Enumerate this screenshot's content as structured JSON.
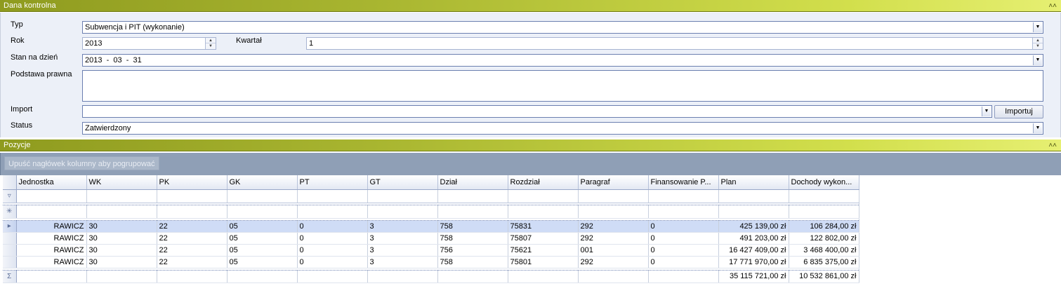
{
  "header1": {
    "title": "Dana kontrolna"
  },
  "form": {
    "typ_label": "Typ",
    "typ_value": "Subwencja i PIT (wykonanie)",
    "rok_label": "Rok",
    "rok_value": "2013",
    "kwartal_label": "Kwartał",
    "kwartal_value": "1",
    "stan_label": "Stan na dzień",
    "stan_value": "2013  -  03  -  31",
    "podstawa_label": "Podstawa prawna",
    "podstawa_value": "",
    "import_label": "Import",
    "import_value": "",
    "import_button": "Importuj",
    "status_label": "Status",
    "status_value": "Zatwierdzony"
  },
  "header2": {
    "title": "Pozycje"
  },
  "group_hint": "Upuść nagłówek kolumny aby pogrupować",
  "grid": {
    "columns": [
      "Jednostka",
      "WK",
      "PK",
      "GK",
      "PT",
      "GT",
      "Dział",
      "Rozdział",
      "Paragraf",
      "Finansowanie P...",
      "Plan",
      "Dochody wykon..."
    ],
    "rows": [
      [
        "RAWICZ",
        "30",
        "22",
        "05",
        "0",
        "3",
        "758",
        "75831",
        "292",
        "0",
        "425 139,00 zł",
        "106 284,00 zł"
      ],
      [
        "RAWICZ",
        "30",
        "22",
        "05",
        "0",
        "3",
        "758",
        "75807",
        "292",
        "0",
        "491 203,00 zł",
        "122 802,00 zł"
      ],
      [
        "RAWICZ",
        "30",
        "22",
        "05",
        "0",
        "3",
        "756",
        "75621",
        "001",
        "0",
        "16 427 409,00 zł",
        "3 468 400,00 zł"
      ],
      [
        "RAWICZ",
        "30",
        "22",
        "05",
        "0",
        "3",
        "758",
        "75801",
        "292",
        "0",
        "17 771 970,00 zł",
        "6 835 375,00 zł"
      ]
    ],
    "totals": {
      "plan": "35 115 721,00 zł",
      "dochody": "10 532 861,00 zł"
    }
  },
  "icons": {
    "collapse": "double-chevron-up-icon",
    "filter": "funnel-icon",
    "new_row": "asterisk-icon",
    "current_row": "triangle-right-icon",
    "sum": "sigma-icon"
  },
  "colors": {
    "header_green": "#a8b530",
    "group_area": "#8f9fb6",
    "selected_row": "#cfdcf6"
  }
}
